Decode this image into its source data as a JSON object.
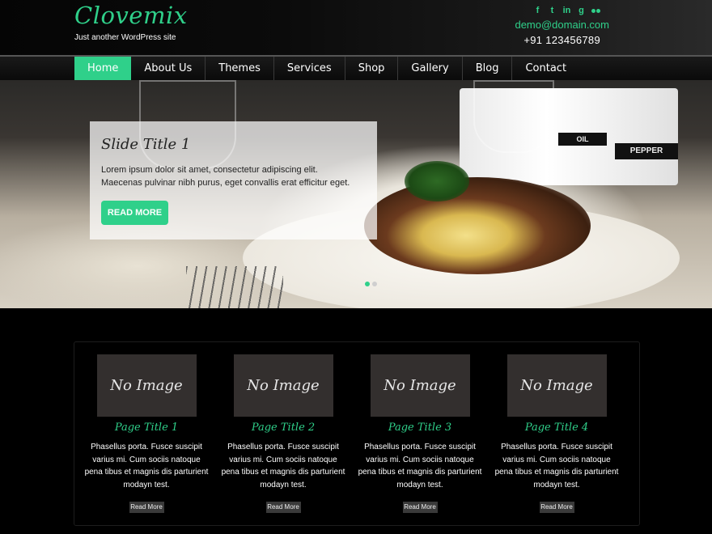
{
  "header": {
    "logo": "Clovemix",
    "tagline": "Just another WordPress site",
    "email": "demo@domain.com",
    "phone": "+91 123456789",
    "social_icons": [
      "facebook-icon",
      "twitter-icon",
      "linkedin-icon",
      "google-plus-icon",
      "flickr-icon"
    ],
    "social_glyphs": [
      "f",
      "t",
      "in",
      "g"
    ]
  },
  "nav": {
    "items": [
      "Home",
      "About Us",
      "Themes",
      "Services",
      "Shop",
      "Gallery",
      "Blog",
      "Contact"
    ],
    "active_index": 0
  },
  "slider": {
    "title": "Slide Title 1",
    "text": "Lorem ipsum dolor sit amet, consectetur adipiscing elit. Maecenas pulvinar nibh purus, eget convallis erat efficitur eget.",
    "button": "READ MORE",
    "image_labels": {
      "oil": "OIL",
      "pepper": "PEPPER"
    },
    "dots": 2,
    "active_dot": 0
  },
  "cards": [
    {
      "image_text": "No Image",
      "title": "Page Title 1",
      "text": "Phasellus porta. Fusce suscipit varius mi. Cum sociis natoque pena tibus et magnis dis parturient modayn test.",
      "button": "Read More"
    },
    {
      "image_text": "No Image",
      "title": "Page Title 2",
      "text": "Phasellus porta. Fusce suscipit varius mi. Cum sociis natoque pena tibus et magnis dis parturient modayn test.",
      "button": "Read More"
    },
    {
      "image_text": "No Image",
      "title": "Page Title 3",
      "text": "Phasellus porta. Fusce suscipit varius mi. Cum sociis natoque pena tibus et magnis dis parturient modayn test.",
      "button": "Read More"
    },
    {
      "image_text": "No Image",
      "title": "Page Title 4",
      "text": "Phasellus porta. Fusce suscipit varius mi. Cum sociis natoque pena tibus et magnis dis parturient modayn test.",
      "button": "Read More"
    }
  ],
  "colors": {
    "accent": "#2fd08a",
    "background": "#000000",
    "placeholder": "#332f2e"
  }
}
